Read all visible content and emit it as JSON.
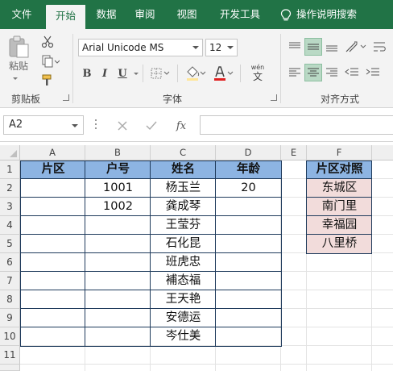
{
  "ribbon_tabs": {
    "file": "文件",
    "home": "开始",
    "data": "数据",
    "review": "审阅",
    "view": "视图",
    "developer": "开发工具",
    "tell_me": "操作说明搜索"
  },
  "ribbon": {
    "clipboard": {
      "paste": "粘贴",
      "group_label": "剪贴板"
    },
    "font": {
      "name": "Arial Unicode MS",
      "size": "12",
      "group_label": "字体",
      "bold": "B",
      "italic": "I",
      "underline": "U",
      "phonetic": "wén"
    },
    "alignment": {
      "group_label": "对齐方式"
    }
  },
  "formula_bar": {
    "name_box": "A2",
    "fx": "fx",
    "formula": ""
  },
  "columns": [
    "A",
    "B",
    "C",
    "D",
    "E",
    "F"
  ],
  "rows": [
    "1",
    "2",
    "3",
    "4",
    "5",
    "6",
    "7",
    "8",
    "9",
    "10",
    "11"
  ],
  "table": {
    "headers": [
      "片区",
      "户号",
      "姓名",
      "年龄"
    ],
    "rows": [
      [
        "",
        "1001",
        "杨玉兰",
        "20"
      ],
      [
        "",
        "1002",
        "龚成琴",
        ""
      ],
      [
        "",
        "",
        "王莹芬",
        ""
      ],
      [
        "",
        "",
        "石化昆",
        ""
      ],
      [
        "",
        "",
        "班虎忠",
        ""
      ],
      [
        "",
        "",
        "補态福",
        ""
      ],
      [
        "",
        "",
        "王天艳",
        ""
      ],
      [
        "",
        "",
        "安德运",
        ""
      ],
      [
        "",
        "",
        "岑仕美",
        ""
      ]
    ]
  },
  "lookup": {
    "header": "片区对照",
    "items": [
      "东城区",
      "南门里",
      "幸福园",
      "八里桥"
    ]
  },
  "colors": {
    "excel_green": "#217346",
    "header_fill": "#8db4e2",
    "lookup_fill": "#f2dcdb",
    "border": "#1f3b5c"
  }
}
